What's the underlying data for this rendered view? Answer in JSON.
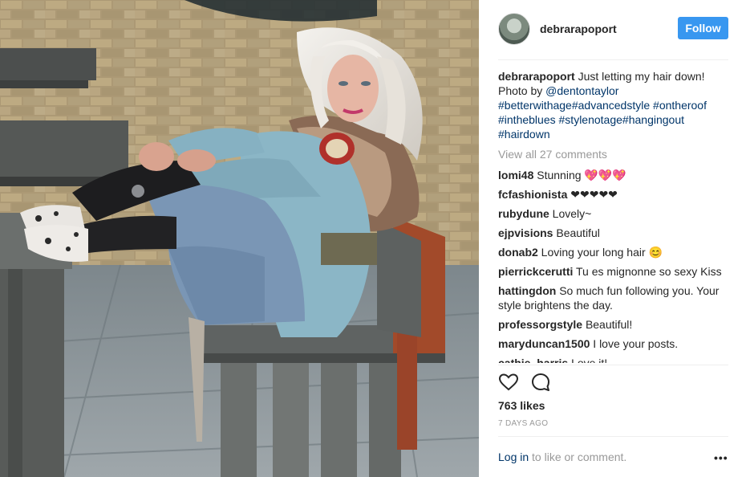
{
  "post": {
    "username": "debrarapoport",
    "follow_label": "Follow"
  },
  "caption": {
    "username": "debrarapoport",
    "text": "Just letting my hair down! Photo by ",
    "mention": "@dentontaylor",
    "hashtags": [
      "#betterwithage",
      "#advancedstyle",
      "#ontheroof",
      "#intheblues",
      "#stylenotage",
      "#hangingout",
      "#hairdown"
    ]
  },
  "view_all_comments": "View all 27 comments",
  "comments": [
    {
      "user": "lomi48",
      "text": "Stunning 💖💖💖"
    },
    {
      "user": "fcfashionista",
      "text": "❤❤❤❤❤"
    },
    {
      "user": "rubydune",
      "text": "Lovely~"
    },
    {
      "user": "ejpvisions",
      "text": "Beautiful"
    },
    {
      "user": "donab2",
      "text": "Loving your long hair 😊"
    },
    {
      "user": "pierrickcerutti",
      "text": "Tu es mignonne so sexy Kiss"
    },
    {
      "user": "hattingdon",
      "text": "So much fun following you. Your style brightens the day."
    },
    {
      "user": "professorgstyle",
      "text": "Beautiful!"
    },
    {
      "user": "maryduncan1500",
      "text": "I love your posts."
    },
    {
      "user": "cathie_harris",
      "text": "Love it!"
    }
  ],
  "likes": "763 likes",
  "time_ago": "7 DAYS AGO",
  "login": {
    "link": "Log in",
    "rest": " to like or comment."
  },
  "more_label": "•••",
  "icons": {
    "like": "heart-icon",
    "comment": "comment-bubble-icon",
    "more": "more-options-icon"
  },
  "colors": {
    "follow_button": "#3897f0",
    "link": "#003569",
    "muted": "#999999"
  }
}
